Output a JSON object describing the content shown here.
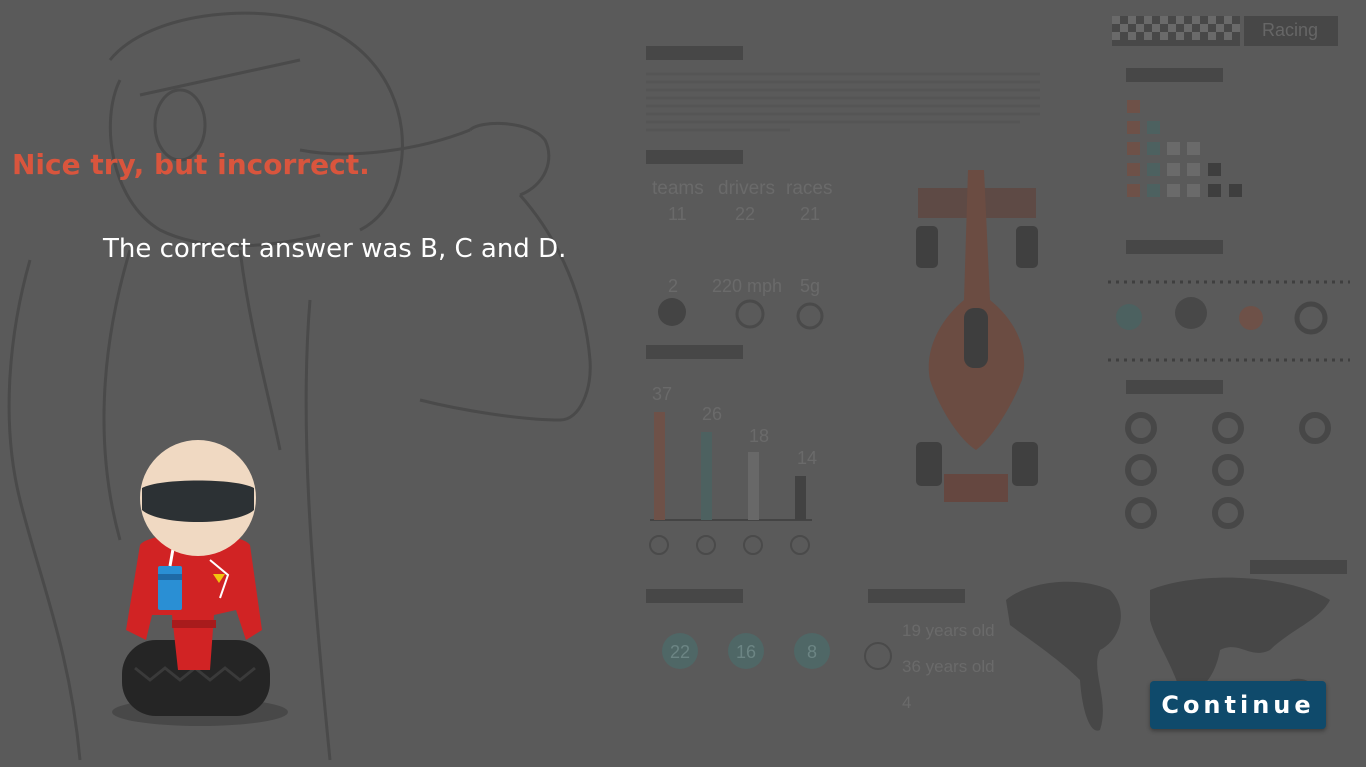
{
  "feedback": {
    "title": "Nice try, but incorrect.",
    "message": "The correct answer was B, C and D."
  },
  "continue_button": {
    "label": "Continue"
  },
  "colors": {
    "background": "#5a5a5a",
    "title": "#d9553d",
    "button": "#0f4a6b",
    "button_text": "#ffffff"
  },
  "infographic": {
    "racing_label": "Racing",
    "stats": {
      "teams": {
        "label": "teams",
        "value": "11"
      },
      "drivers": {
        "label": "drivers",
        "value": "22"
      },
      "races": {
        "label": "races",
        "value": "21"
      },
      "pitstop": {
        "value": "2"
      },
      "speed": {
        "value": "220 mph"
      },
      "gforce": {
        "value": "5g"
      }
    },
    "bars": [
      "37",
      "26",
      "18",
      "14"
    ],
    "qualifying": [
      "22",
      "16",
      "8"
    ],
    "drivers_ages": {
      "youngest": "19 years old",
      "oldest": "36 years old",
      "other": "4"
    }
  }
}
